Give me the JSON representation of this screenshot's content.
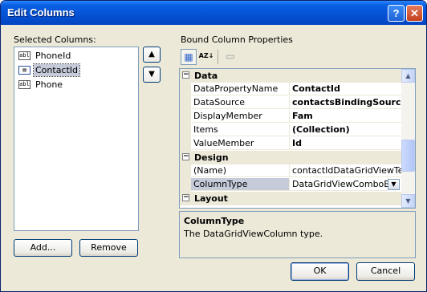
{
  "window": {
    "title": "Edit Columns",
    "help_glyph": "?",
    "close_glyph": "✕"
  },
  "selected_columns": {
    "label": "Selected Columns:",
    "items": [
      {
        "label": "PhoneId",
        "icon": "textbox-column-icon",
        "icon_text": "abl",
        "selected": false
      },
      {
        "label": "ContactId",
        "icon": "combobox-column-icon",
        "icon_text": "▤",
        "selected": true
      },
      {
        "label": "Phone",
        "icon": "textbox-column-icon",
        "icon_text": "abl",
        "selected": false
      }
    ],
    "move_up": "▲",
    "move_down": "▼",
    "add_label": "Add...",
    "remove_label": "Remove"
  },
  "properties": {
    "label": "Bound Column Properties",
    "toolbar": {
      "categorized": "▦",
      "alphabetical": "AZ↓",
      "pages": "▭"
    },
    "categories": [
      {
        "name": "Data",
        "expand": "−"
      },
      {
        "name": "Design",
        "expand": "−"
      },
      {
        "name": "Layout",
        "expand": "−"
      }
    ],
    "data_rows": [
      {
        "name": "DataPropertyName",
        "value": "ContactId"
      },
      {
        "name": "DataSource",
        "value": "contactsBindingSource"
      },
      {
        "name": "DisplayMember",
        "value": "Fam"
      },
      {
        "name": "Items",
        "value": "(Collection)"
      },
      {
        "name": "ValueMember",
        "value": "Id"
      }
    ],
    "design_rows": [
      {
        "name": "(Name)",
        "value": "contactIdDataGridViewTextB"
      },
      {
        "name": "ColumnType",
        "value": "DataGridViewComboBoxC"
      }
    ],
    "dropdown_glyph": "▼",
    "scroll_up": "▲",
    "scroll_down": "▼",
    "description": {
      "title": "ColumnType",
      "text": "The DataGridViewColumn type."
    }
  },
  "buttons": {
    "ok": "OK",
    "cancel": "Cancel"
  }
}
